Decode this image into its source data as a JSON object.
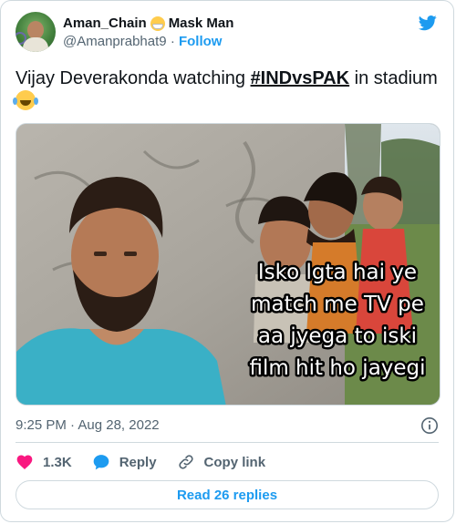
{
  "author": {
    "display_name": "Aman_Chain",
    "display_name_suffix": "Mask Man",
    "name_emoji_icon": "face-with-medical-mask-icon",
    "handle": "@Amanprabhat9",
    "separator": "·",
    "follow_label": "Follow"
  },
  "tweet": {
    "text_before": "Vijay Deverakonda watching ",
    "hashtag": "#INDvsPAK",
    "text_after": " in stadium",
    "trailing_emoji_icon": "face-with-tears-of-joy-icon"
  },
  "media": {
    "caption_lines": [
      "Isko lgta hai ye",
      "match me TV pe",
      "aa jyega to iski",
      "film hit ho jayegi"
    ]
  },
  "meta": {
    "time": "9:25 PM",
    "separator": "·",
    "date": "Aug 28, 2022"
  },
  "actions": {
    "like_count": "1.3K",
    "reply_label": "Reply",
    "copy_link_label": "Copy link"
  },
  "read_replies_label": "Read 26 replies",
  "colors": {
    "accent": "#1d9bf0",
    "like": "#f91880",
    "text": "#0f1419",
    "secondary": "#536471",
    "border": "#cfd9de"
  }
}
